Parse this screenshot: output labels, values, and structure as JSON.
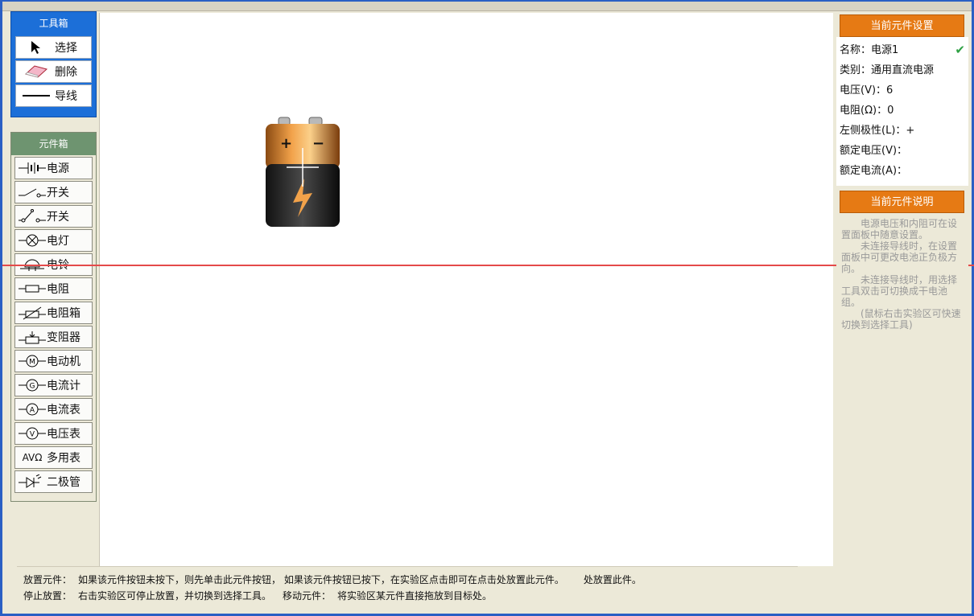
{
  "toolbox": {
    "title": "工具箱",
    "tools": [
      {
        "label": "选择",
        "icon": "arrow-cursor-icon"
      },
      {
        "label": "删除",
        "icon": "eraser-icon"
      },
      {
        "label": "导线",
        "icon": "wire-line-icon"
      }
    ]
  },
  "components": {
    "title": "元件箱",
    "items": [
      {
        "label": "电源",
        "icon": "battery-symbol-icon"
      },
      {
        "label": "开关",
        "icon": "switch-symbol-icon"
      },
      {
        "label": "开关",
        "icon": "spdt-switch-symbol-icon"
      },
      {
        "label": "电灯",
        "icon": "lamp-symbol-icon"
      },
      {
        "label": "电铃",
        "icon": "bell-symbol-icon"
      },
      {
        "label": "电阻",
        "icon": "resistor-symbol-icon"
      },
      {
        "label": "电阻箱",
        "icon": "resistor-box-symbol-icon"
      },
      {
        "label": "变阻器",
        "icon": "rheostat-symbol-icon"
      },
      {
        "label": "电动机",
        "icon": "motor-symbol-icon",
        "glyph": "M"
      },
      {
        "label": "电流计",
        "icon": "galvanometer-symbol-icon",
        "glyph": "G"
      },
      {
        "label": "电流表",
        "icon": "ammeter-symbol-icon",
        "glyph": "A"
      },
      {
        "label": "电压表",
        "icon": "voltmeter-symbol-icon",
        "glyph": "V"
      },
      {
        "label": "多用表",
        "icon": "multimeter-symbol-icon",
        "glyph": "AVΩ"
      },
      {
        "label": "二极管",
        "icon": "diode-symbol-icon"
      }
    ]
  },
  "canvas": {
    "battery": {
      "plus": "+",
      "minus": "−"
    }
  },
  "status": {
    "row1_label": "放置元件：",
    "row1_text": "如果该元件按钮未按下，则先单击此元件按钮， 如果该元件按钮已按下，在实验区点击即可在点击处放置此元件。",
    "row1_tail": "处放置此件。",
    "row2_label": "停止放置：",
    "row2_text": "右击实验区可停止放置，并切换到选择工具。",
    "row2_label2": "移动元件：",
    "row2_text2": "将实验区某元件直接拖放到目标处。"
  },
  "settings": {
    "title": "当前元件设置",
    "name": "名称：电源1",
    "type": "类别：通用直流电源",
    "voltage": "电压(V)：6",
    "resistance": "电阻(Ω)：0",
    "polarity": "左侧极性(L)：+",
    "rated_voltage": "额定电压(V)：",
    "rated_current": "额定电流(A)："
  },
  "description": {
    "title": "当前元件说明",
    "lines": [
      "电源电压和内阻可在设置面板中随意设置。",
      "未连接导线时，在设置面板中可更改电池正负极方向。",
      "未连接导线时，用选择工具双击可切换成干电池组。",
      "(鼠标右击实验区可快速切换到选择工具)"
    ]
  },
  "colors": {
    "toolbox": "#1c6fd8",
    "component_header": "#6e9470",
    "orange_header": "#e67a14",
    "guide_line": "#e44a4a"
  }
}
